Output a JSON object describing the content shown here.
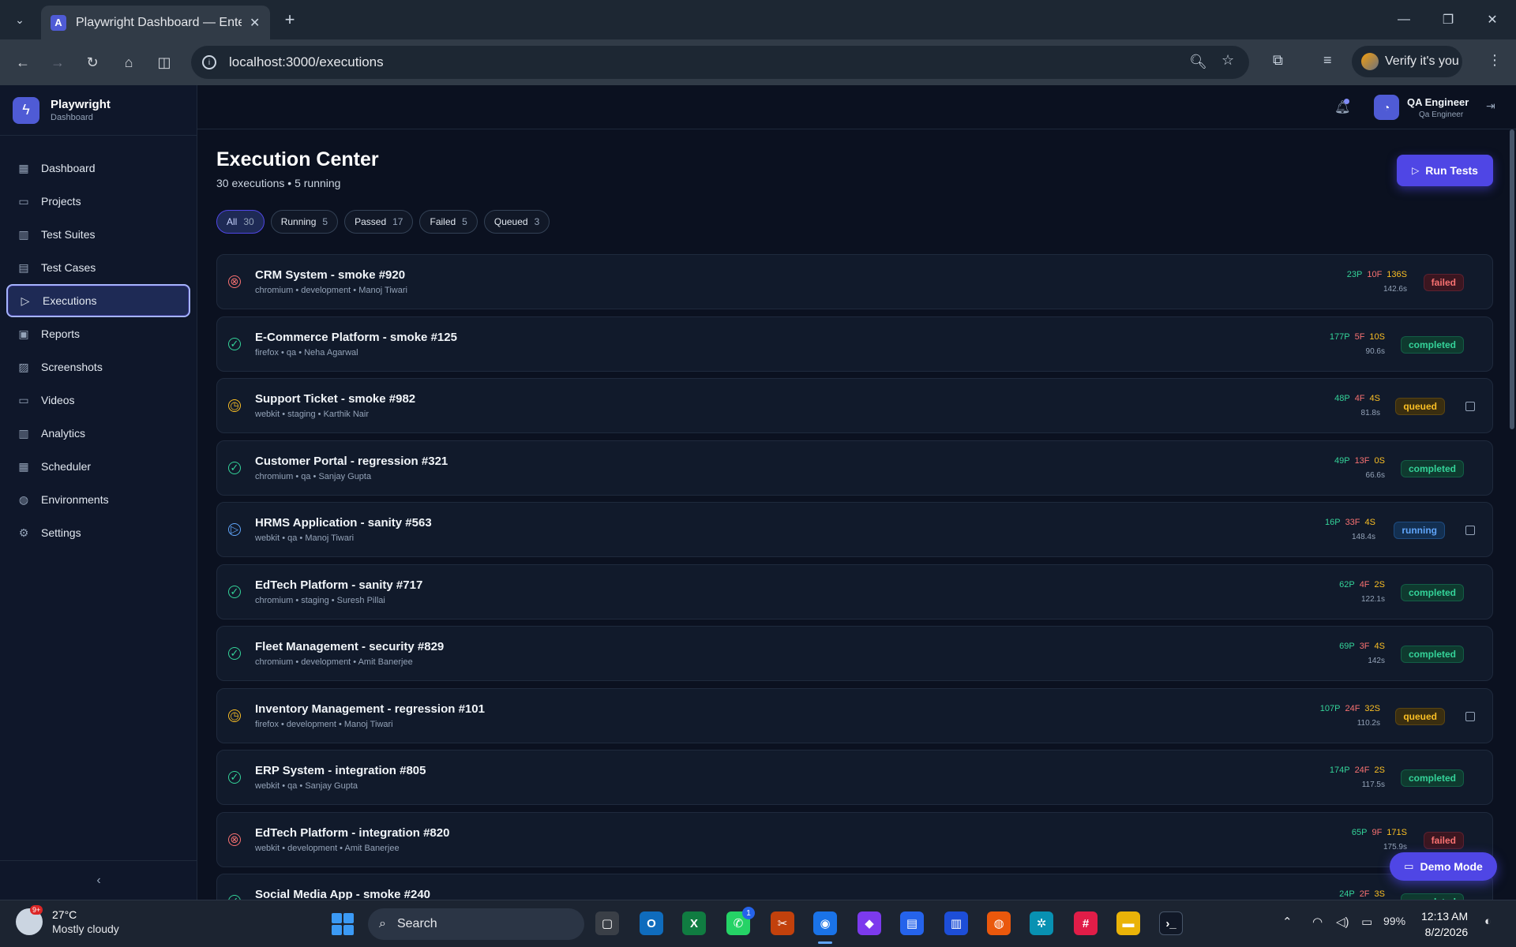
{
  "browser": {
    "tab_title": "Playwright Dashboard — Enterp",
    "tab_favicon": "A",
    "url": "localhost:3000/executions",
    "verify_label": "Verify it's you"
  },
  "sidebar": {
    "brand_name": "Playwright",
    "brand_sub": "Dashboard",
    "items": [
      {
        "label": "Dashboard",
        "icon": "grid-icon"
      },
      {
        "label": "Projects",
        "icon": "folder-icon"
      },
      {
        "label": "Test Suites",
        "icon": "columns-icon"
      },
      {
        "label": "Test Cases",
        "icon": "file-icon"
      },
      {
        "label": "Executions",
        "icon": "play-icon"
      },
      {
        "label": "Reports",
        "icon": "clipboard-icon"
      },
      {
        "label": "Screenshots",
        "icon": "image-icon"
      },
      {
        "label": "Videos",
        "icon": "video-icon"
      },
      {
        "label": "Analytics",
        "icon": "chart-icon"
      },
      {
        "label": "Scheduler",
        "icon": "calendar-icon"
      },
      {
        "label": "Environments",
        "icon": "globe-icon"
      },
      {
        "label": "Settings",
        "icon": "gear-icon"
      }
    ]
  },
  "topbar": {
    "user_name": "QA Engineer",
    "user_role": "Qa Engineer"
  },
  "page": {
    "title": "Execution Center",
    "subtitle": "30 executions • 5 running",
    "run_button": "Run Tests",
    "filters": [
      {
        "label": "All",
        "count": "30"
      },
      {
        "label": "Running",
        "count": "5"
      },
      {
        "label": "Passed",
        "count": "17"
      },
      {
        "label": "Failed",
        "count": "5"
      },
      {
        "label": "Queued",
        "count": "3"
      }
    ]
  },
  "executions": [
    {
      "title": "CRM System - smoke #920",
      "meta": "chromium • development • Manoj Tiwari",
      "p": "23P",
      "f": "10F",
      "s": "136S",
      "dur": "142.6s",
      "status": "failed"
    },
    {
      "title": "E-Commerce Platform - smoke #125",
      "meta": "firefox • qa • Neha Agarwal",
      "p": "177P",
      "f": "5F",
      "s": "10S",
      "dur": "90.6s",
      "status": "completed"
    },
    {
      "title": "Support Ticket - smoke #982",
      "meta": "webkit • staging • Karthik Nair",
      "p": "48P",
      "f": "4F",
      "s": "4S",
      "dur": "81.8s",
      "status": "queued"
    },
    {
      "title": "Customer Portal - regression #321",
      "meta": "chromium • qa • Sanjay Gupta",
      "p": "49P",
      "f": "13F",
      "s": "0S",
      "dur": "66.6s",
      "status": "completed"
    },
    {
      "title": "HRMS Application - sanity #563",
      "meta": "webkit • qa • Manoj Tiwari",
      "p": "16P",
      "f": "33F",
      "s": "4S",
      "dur": "148.4s",
      "status": "running"
    },
    {
      "title": "EdTech Platform - sanity #717",
      "meta": "chromium • staging • Suresh Pillai",
      "p": "62P",
      "f": "4F",
      "s": "2S",
      "dur": "122.1s",
      "status": "completed"
    },
    {
      "title": "Fleet Management - security #829",
      "meta": "chromium • development • Amit Banerjee",
      "p": "69P",
      "f": "3F",
      "s": "4S",
      "dur": "142s",
      "status": "completed"
    },
    {
      "title": "Inventory Management - regression #101",
      "meta": "firefox • development • Manoj Tiwari",
      "p": "107P",
      "f": "24F",
      "s": "32S",
      "dur": "110.2s",
      "status": "queued"
    },
    {
      "title": "ERP System - integration #805",
      "meta": "webkit • qa • Sanjay Gupta",
      "p": "174P",
      "f": "24F",
      "s": "2S",
      "dur": "117.5s",
      "status": "completed"
    },
    {
      "title": "EdTech Platform - integration #820",
      "meta": "webkit • development • Amit Banerjee",
      "p": "65P",
      "f": "9F",
      "s": "171S",
      "dur": "175.9s",
      "status": "failed"
    },
    {
      "title": "Social Media App - smoke #240",
      "meta": "",
      "p": "24P",
      "f": "2F",
      "s": "3S",
      "dur": "",
      "status": "completed"
    }
  ],
  "demo_button": "Demo Mode",
  "taskbar": {
    "temp": "27°C",
    "condition": "Mostly cloudy",
    "weather_badge": "9+",
    "search_label": "Search",
    "battery": "99%",
    "time": "12:13 AM",
    "date": "8/2/2026",
    "whatsapp_badge": "1"
  },
  "colors": {
    "accent": "#4f46e5",
    "passed": "#34d399",
    "failed": "#f87171",
    "skipped": "#fbbf24",
    "running": "#60a5fa"
  }
}
